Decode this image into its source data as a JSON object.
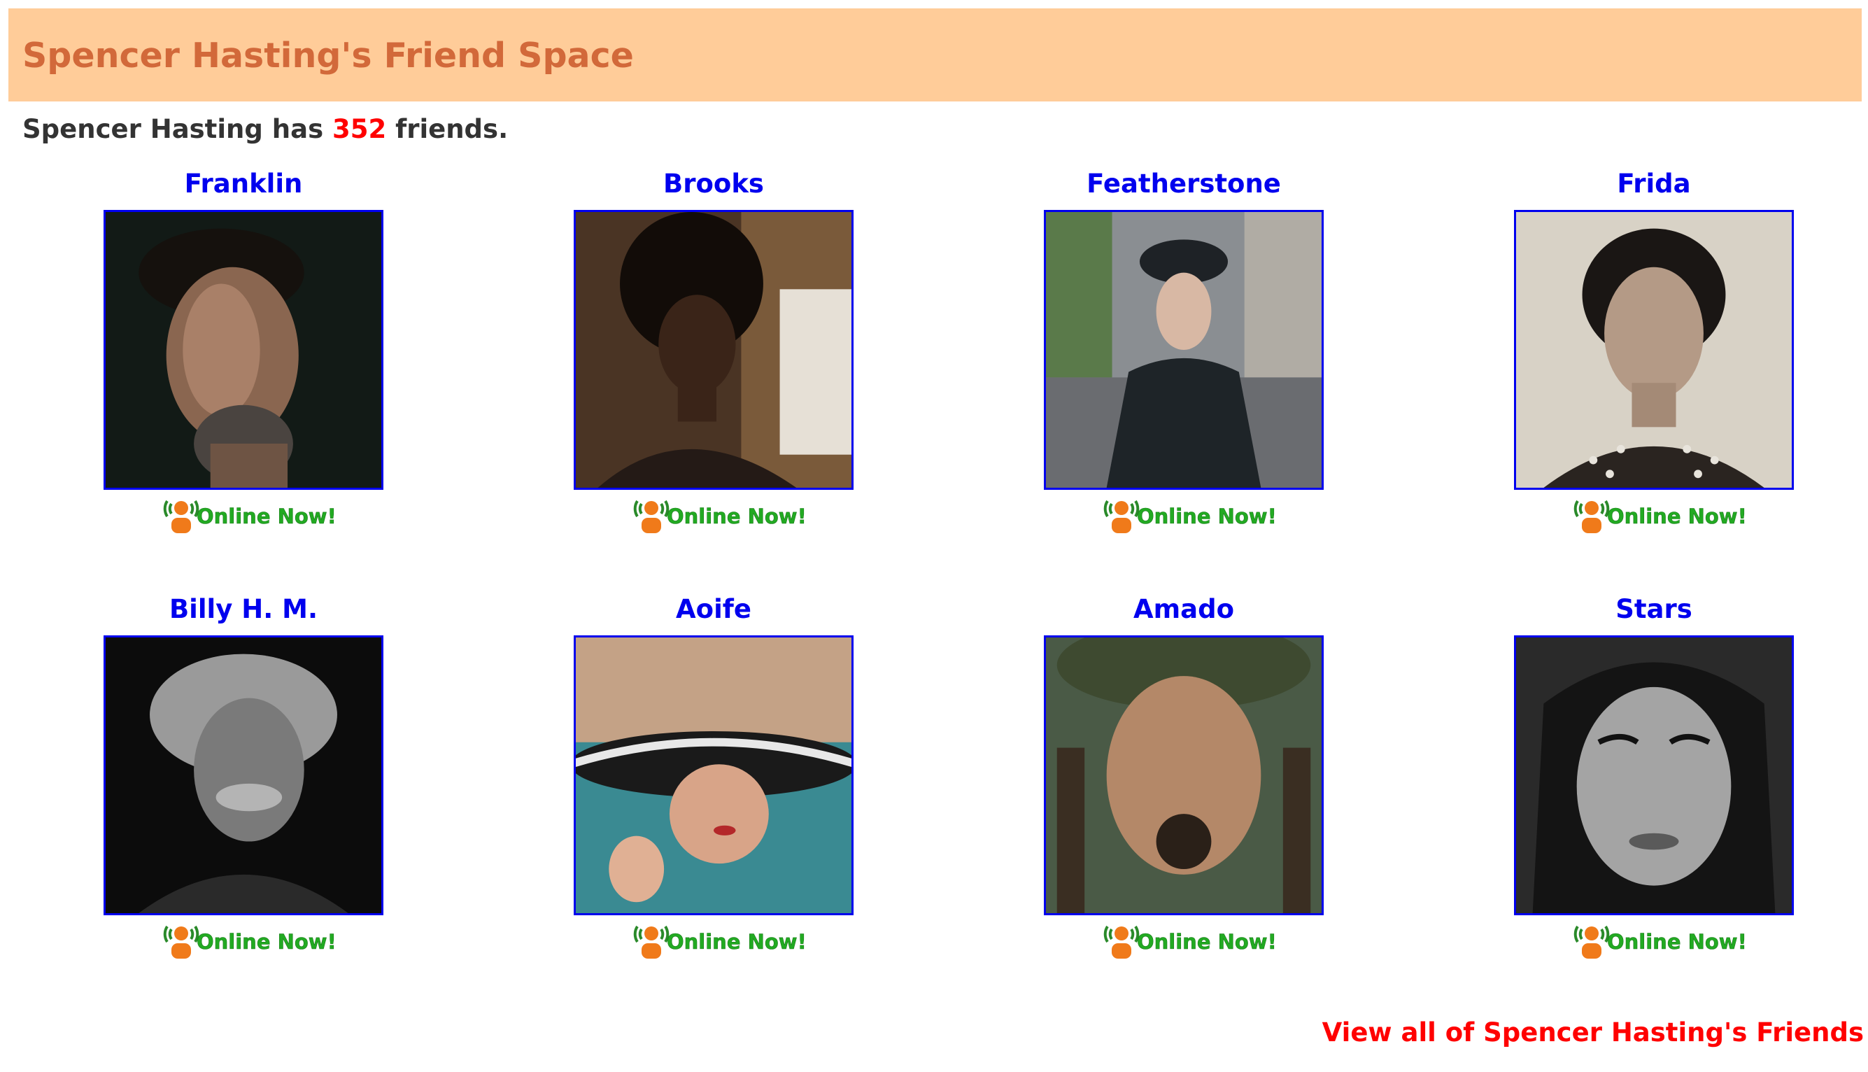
{
  "header": {
    "title": "Spencer Hasting's Friend Space"
  },
  "summary": {
    "prefix": "Spencer Hasting has ",
    "count": "352",
    "suffix": " friends."
  },
  "friends": [
    {
      "name": "Franklin",
      "status": "Online Now!",
      "photo": "photo-franklin"
    },
    {
      "name": "Brooks",
      "status": "Online Now!",
      "photo": "photo-brooks"
    },
    {
      "name": "Featherstone",
      "status": "Online Now!",
      "photo": "photo-featherstone"
    },
    {
      "name": "Frida",
      "status": "Online Now!",
      "photo": "photo-frida"
    },
    {
      "name": "Billy H. M.",
      "status": "Online Now!",
      "photo": "photo-billy"
    },
    {
      "name": "Aoife",
      "status": "Online Now!",
      "photo": "photo-aoife"
    },
    {
      "name": "Amado",
      "status": "Online Now!",
      "photo": "photo-amado"
    },
    {
      "name": "Stars",
      "status": "Online Now!",
      "photo": "photo-stars"
    }
  ],
  "footer": {
    "view_all_label": "View all of Spencer Hasting's Friends"
  },
  "colors": {
    "header_bg": "#ffcc99",
    "header_text": "#d2693a",
    "link_blue": "#0000ee",
    "count_red": "#ff0000",
    "online_green": "#22aa22",
    "online_icon_orange": "#f07a1a"
  },
  "icons": {
    "online_indicator": "online-person-icon"
  }
}
